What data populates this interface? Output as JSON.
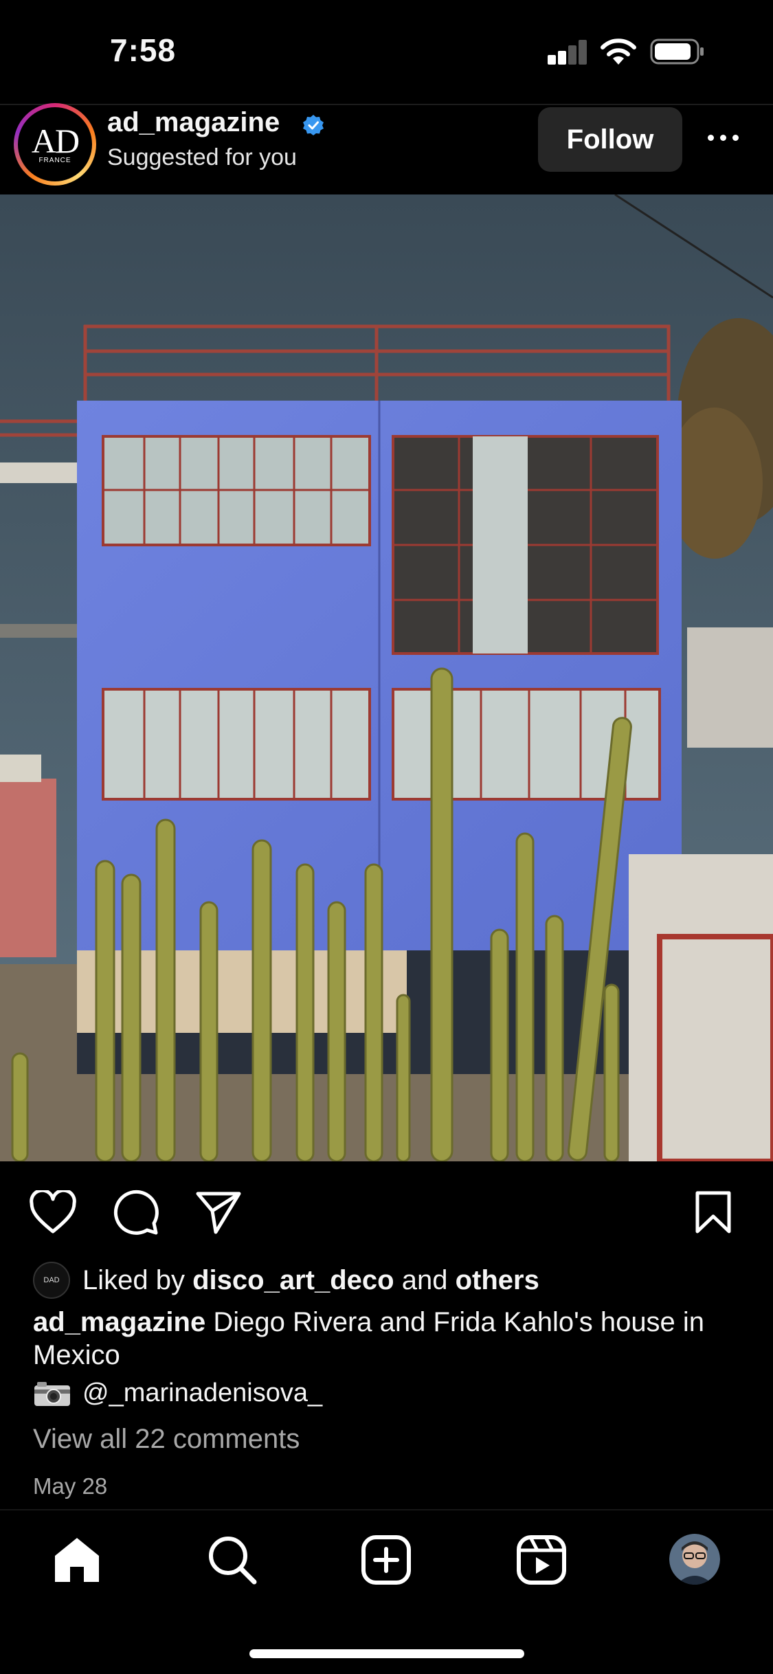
{
  "status_bar": {
    "time": "7:58"
  },
  "post_header": {
    "username": "ad_magazine",
    "subtitle": "Suggested for you",
    "avatar_text": "AD",
    "avatar_subtext": "FRANCE",
    "follow_label": "Follow",
    "verified": true
  },
  "post": {
    "photo_description_icon": "photo",
    "liked_by_prefix": "Liked by",
    "liked_by_user": "disco_art_deco",
    "liked_by_and": "and",
    "liked_by_others": "others",
    "liked_avatar_text": "DAD",
    "caption_user": "ad_magazine",
    "caption_text": "Diego Rivera and Frida Kahlo's house in Mexico",
    "credit_handle": "@_marinadenisova_",
    "comments_link": "View all 22 comments",
    "date": "May 28"
  },
  "actions": [
    "heart-icon",
    "comment-icon",
    "share-icon",
    "bookmark-icon"
  ],
  "tabbar": [
    "home-icon",
    "search-icon",
    "create-icon",
    "reels-icon",
    "profile-avatar"
  ],
  "colors": {
    "background": "#000000",
    "verified": "#3897f0",
    "follow_bg": "#262626",
    "secondary_text": "#a8a8a8"
  }
}
